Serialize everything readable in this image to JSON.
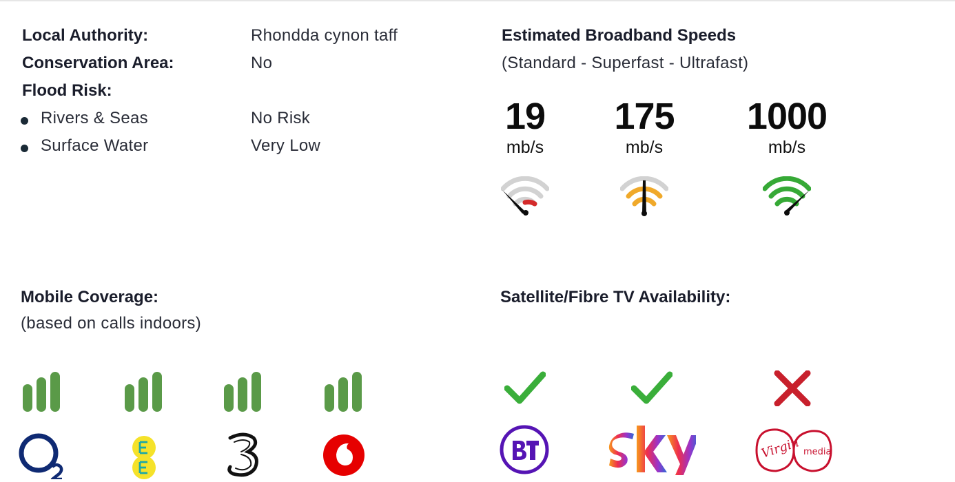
{
  "property": {
    "local_authority_label": "Local Authority:",
    "local_authority_value": "Rhondda cynon taff",
    "conservation_label": "Conservation Area:",
    "conservation_value": "No",
    "flood_label": "Flood Risk:",
    "flood_items": [
      {
        "label": "Rivers & Seas",
        "value": "No Risk"
      },
      {
        "label": "Surface Water",
        "value": "Very Low"
      }
    ]
  },
  "broadband": {
    "title": "Estimated Broadband Speeds",
    "subtitle": "(Standard - Superfast - Ultrafast)",
    "speeds": [
      {
        "value": "19",
        "unit": "mb/s",
        "color": "#d42b2b",
        "icon": "speedometer-red-icon"
      },
      {
        "value": "175",
        "unit": "mb/s",
        "color": "#f0a92a",
        "icon": "speedometer-amber-icon"
      },
      {
        "value": "1000",
        "unit": "mb/s",
        "color": "#36a936",
        "icon": "speedometer-green-icon"
      }
    ]
  },
  "mobile": {
    "title": "Mobile Coverage:",
    "subtitle": "(based on calls indoors)",
    "bar_color": "#5a9a48",
    "operators": [
      {
        "icon": "o2-logo-icon",
        "signal_bars": 3
      },
      {
        "icon": "ee-logo-icon",
        "signal_bars": 3
      },
      {
        "icon": "three-logo-icon",
        "signal_bars": 3
      },
      {
        "icon": "vodafone-logo-icon",
        "signal_bars": 3
      }
    ]
  },
  "tv": {
    "title": "Satellite/Fibre TV Availability:",
    "tick_color": "#3aae3a",
    "cross_color": "#c8202c",
    "providers": [
      {
        "icon": "bt-logo-icon",
        "available": true
      },
      {
        "icon": "sky-logo-icon",
        "available": true
      },
      {
        "icon": "virgin-media-logo-icon",
        "available": false
      }
    ]
  }
}
